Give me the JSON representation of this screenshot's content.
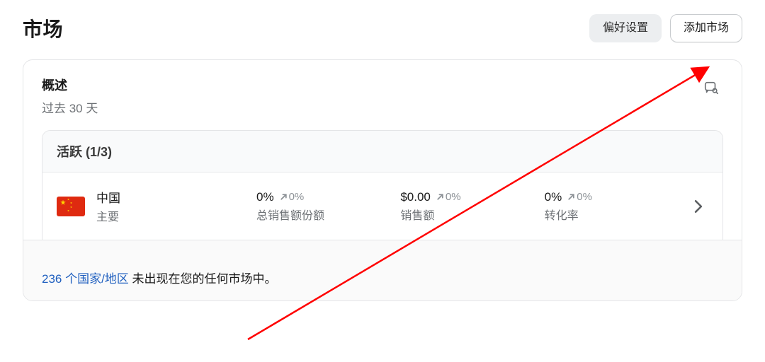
{
  "header": {
    "title": "市场",
    "preferences_label": "偏好设置",
    "add_market_label": "添加市场"
  },
  "overview": {
    "title": "概述",
    "subtitle": "过去 30 天",
    "active_heading": "活跃 (1/3)"
  },
  "market": {
    "name": "中国",
    "tag": "主要",
    "stats": [
      {
        "value": "0%",
        "delta": "0%",
        "label": "总销售额份额"
      },
      {
        "value": "$0.00",
        "delta": "0%",
        "label": "销售额"
      },
      {
        "value": "0%",
        "delta": "0%",
        "label": "转化率"
      }
    ]
  },
  "footer": {
    "link_text": "236 个国家/地区",
    "suffix": " 未出现在您的任何市场中。"
  }
}
